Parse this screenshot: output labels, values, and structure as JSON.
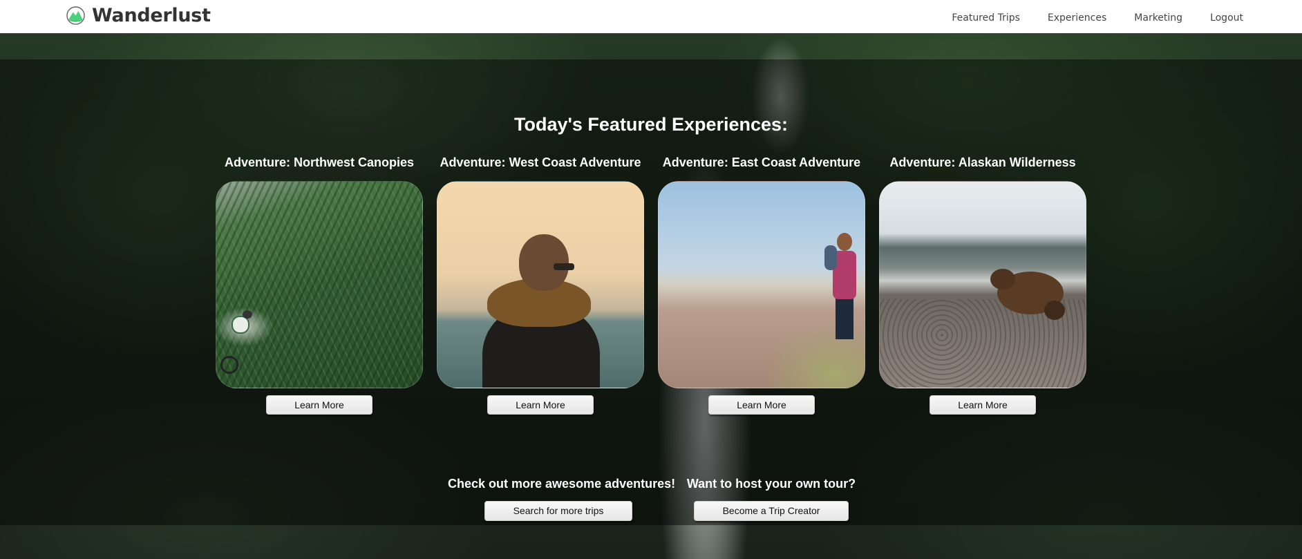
{
  "navbar": {
    "brand": "Wanderlust",
    "links": [
      "Featured Trips",
      "Experiences",
      "Marketing",
      "Logout"
    ]
  },
  "featured": {
    "title": "Today's Featured Experiences:",
    "cards": [
      {
        "title": "Adventure: Northwest Canopies",
        "button": "Learn More"
      },
      {
        "title": "Adventure: West Coast Adventure",
        "button": "Learn More"
      },
      {
        "title": "Adventure: East Coast Adventure",
        "button": "Learn More"
      },
      {
        "title": "Adventure: Alaskan Wilderness",
        "button": "Learn More"
      }
    ]
  },
  "cta": {
    "search": {
      "heading": "Check out more awesome adventures!",
      "button": "Search for more trips"
    },
    "host": {
      "heading": "Want to host your own tour?",
      "button": "Become a Trip Creator"
    }
  },
  "colors": {
    "logo_green": "#4cd07d",
    "navbar_bg": "#ffffff",
    "text_light": "#ffffff"
  }
}
